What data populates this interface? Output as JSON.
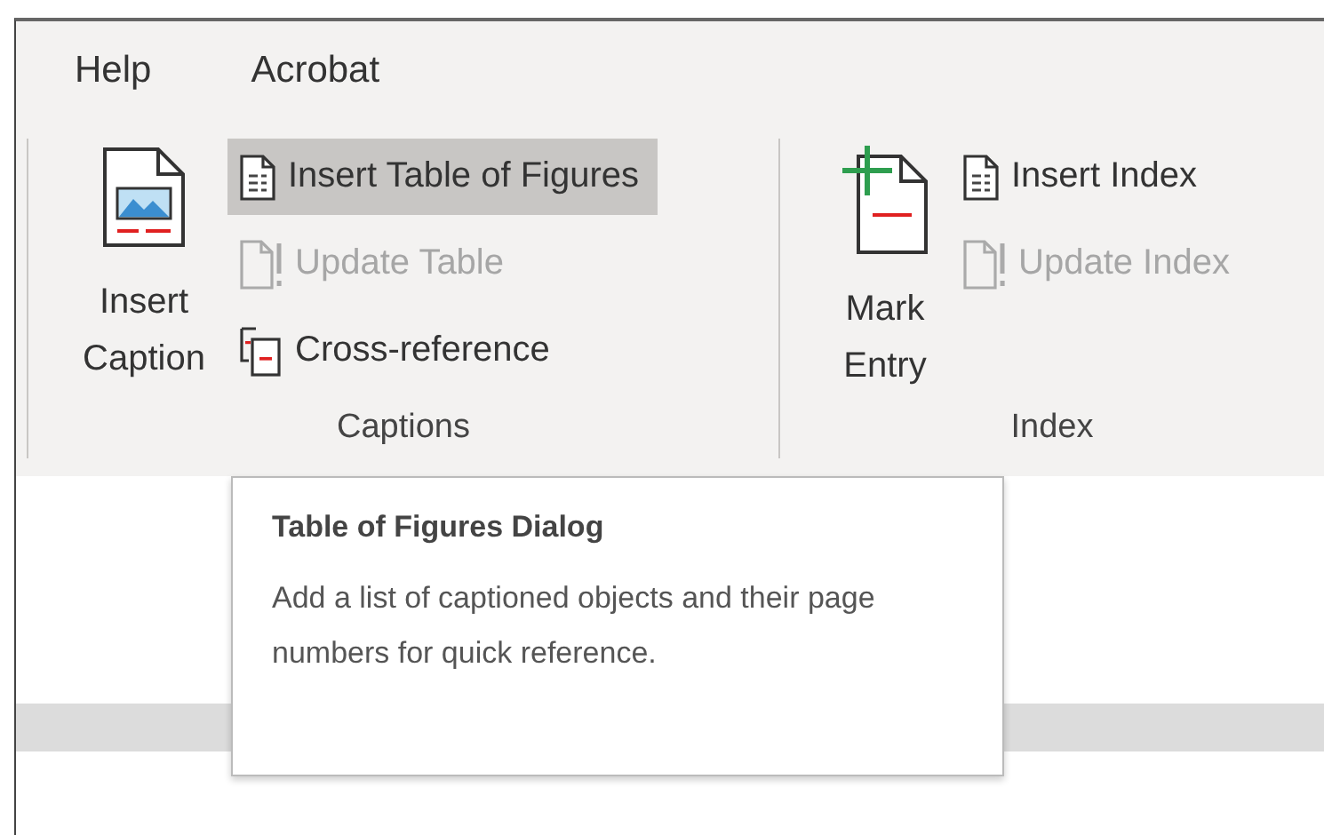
{
  "tabs": [
    {
      "label": "Help"
    },
    {
      "label": "Acrobat"
    }
  ],
  "groups": [
    {
      "label": "Captions",
      "large": {
        "label": "Insert Caption",
        "kind": "caption"
      },
      "small": [
        {
          "label": "Insert Table of Figures",
          "kind": "table",
          "disabled": false,
          "highlighted": true
        },
        {
          "label": "Update Table",
          "kind": "update",
          "disabled": true,
          "highlighted": false
        },
        {
          "label": "Cross-reference",
          "kind": "crossref",
          "disabled": false,
          "highlighted": false
        }
      ]
    },
    {
      "label": "Index",
      "large": {
        "label": "Mark Entry",
        "kind": "mark"
      },
      "small": [
        {
          "label": "Insert Index",
          "kind": "table",
          "disabled": false,
          "highlighted": false
        },
        {
          "label": "Update Index",
          "kind": "update",
          "disabled": true,
          "highlighted": false
        }
      ]
    }
  ],
  "tooltip": {
    "title": "Table of Figures Dialog",
    "text": "Add a list of captioned objects and their page numbers for quick reference."
  }
}
